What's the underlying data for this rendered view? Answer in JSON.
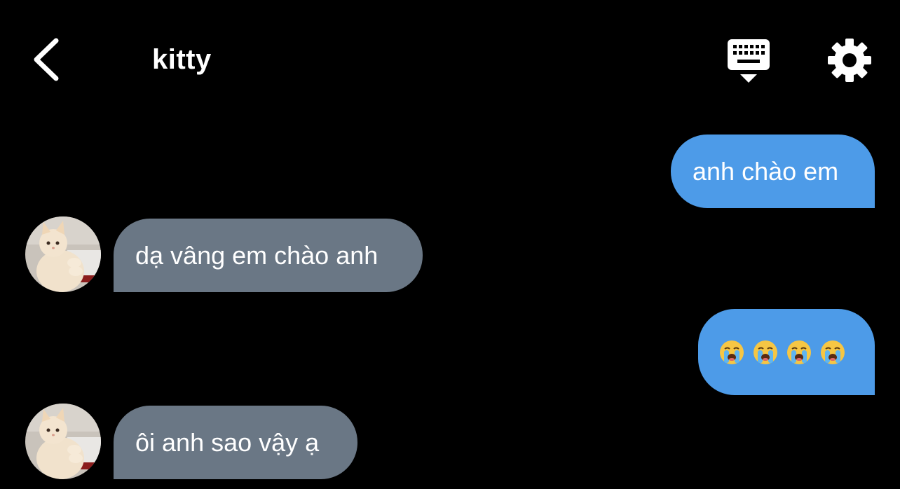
{
  "header": {
    "title": "kitty",
    "back_icon": "chevron-left-icon",
    "keyboard_icon": "keyboard-hide-icon",
    "settings_icon": "gear-icon"
  },
  "messages": [
    {
      "direction": "sent",
      "text": "anh chào em"
    },
    {
      "direction": "received",
      "text": "dạ vâng em chào anh",
      "avatar": "cat-typing-avatar"
    },
    {
      "direction": "sent",
      "text": "😭😭😭😭",
      "emoji_name": "loudly-crying-face",
      "emoji_count": 4
    },
    {
      "direction": "received",
      "text": "ôi anh sao vậy ạ",
      "avatar": "cat-typing-avatar"
    }
  ],
  "colors": {
    "background": "#000000",
    "sent_bubble": "#4d9be8",
    "received_bubble": "#6a7785",
    "text": "#ffffff"
  }
}
